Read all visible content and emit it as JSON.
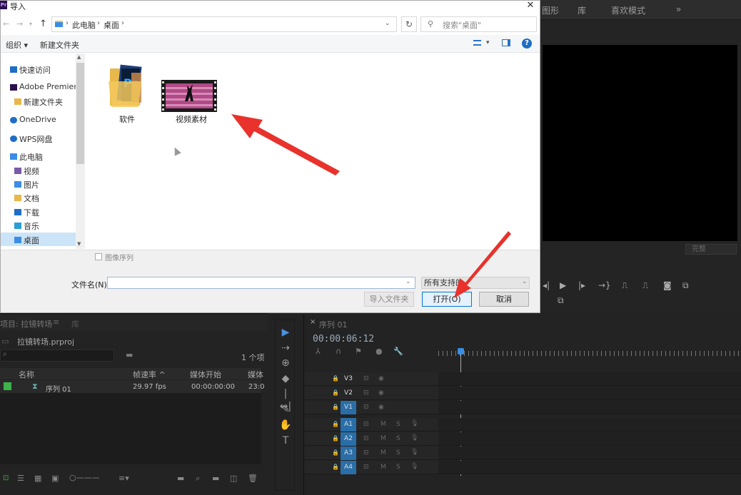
{
  "premiere": {
    "topbar": {
      "items": [
        "图形",
        "库",
        "喜欢模式",
        "»"
      ]
    },
    "fit_select": "完整",
    "project": {
      "tab_label": "项目: 拉镜转场",
      "tab_menu": "≡",
      "library_tab": "库",
      "file_name": "拉镜转场.prproj",
      "items_count": "1 个项",
      "headers": [
        "名称",
        "帧速率 ^",
        "媒体开始",
        "媒体"
      ],
      "rows": [
        {
          "name": "序列 01",
          "fps": "29.97 fps",
          "start": "00:00:00:00",
          "media": "23:0"
        }
      ]
    },
    "timeline": {
      "sequence_tab": "序列 01",
      "timecode": "00:00:06:12",
      "source_label": "V1",
      "video_tracks": [
        "V3",
        "V2",
        "V1"
      ],
      "audio_tracks": [
        "A1",
        "A2",
        "A3",
        "A4"
      ],
      "m_label": "M",
      "s_label": "S"
    }
  },
  "dialog": {
    "title_icon": "Pr",
    "title": "导入",
    "close": "✕",
    "address": {
      "pc": "此电脑",
      "desktop": "桌面",
      "separator": "›"
    },
    "search_placeholder": "搜索\"桌面\"",
    "toolbar": {
      "organize": "组织 ▾",
      "new_folder": "新建文件夹",
      "help": "?"
    },
    "nav": [
      {
        "label": "快速访问",
        "icon": "star-icon"
      },
      {
        "label": "Adobe Premiere",
        "icon": "premiere-icon"
      },
      {
        "label": "新建文件夹",
        "icon": "folder-icon"
      },
      {
        "label": "OneDrive",
        "icon": "cloud-icon"
      },
      {
        "label": "WPS网盘",
        "icon": "cloud-icon"
      },
      {
        "label": "此电脑",
        "icon": "computer-icon"
      },
      {
        "label": "视频",
        "icon": "video-folder-icon"
      },
      {
        "label": "图片",
        "icon": "pictures-folder-icon"
      },
      {
        "label": "文档",
        "icon": "documents-folder-icon"
      },
      {
        "label": "下载",
        "icon": "downloads-folder-icon"
      },
      {
        "label": "音乐",
        "icon": "music-folder-icon"
      },
      {
        "label": "桌面",
        "icon": "desktop-folder-icon"
      }
    ],
    "files": [
      {
        "label": "软件",
        "icon": "photoshop-folder-icon"
      },
      {
        "label": "视频素材",
        "icon": "video-file-icon"
      }
    ],
    "image_sequence_label": "图像序列",
    "filename_label": "文件名(N):",
    "filename_value": "",
    "filetype_value": "所有支持的",
    "buttons": {
      "import_folder": "导入文件夹",
      "open": "打开(O)",
      "cancel": "取消"
    }
  },
  "colors": {
    "annotation_arrow": "#e8322b",
    "accent": "#0078d7",
    "premiere_blue": "#2a6ea8"
  }
}
